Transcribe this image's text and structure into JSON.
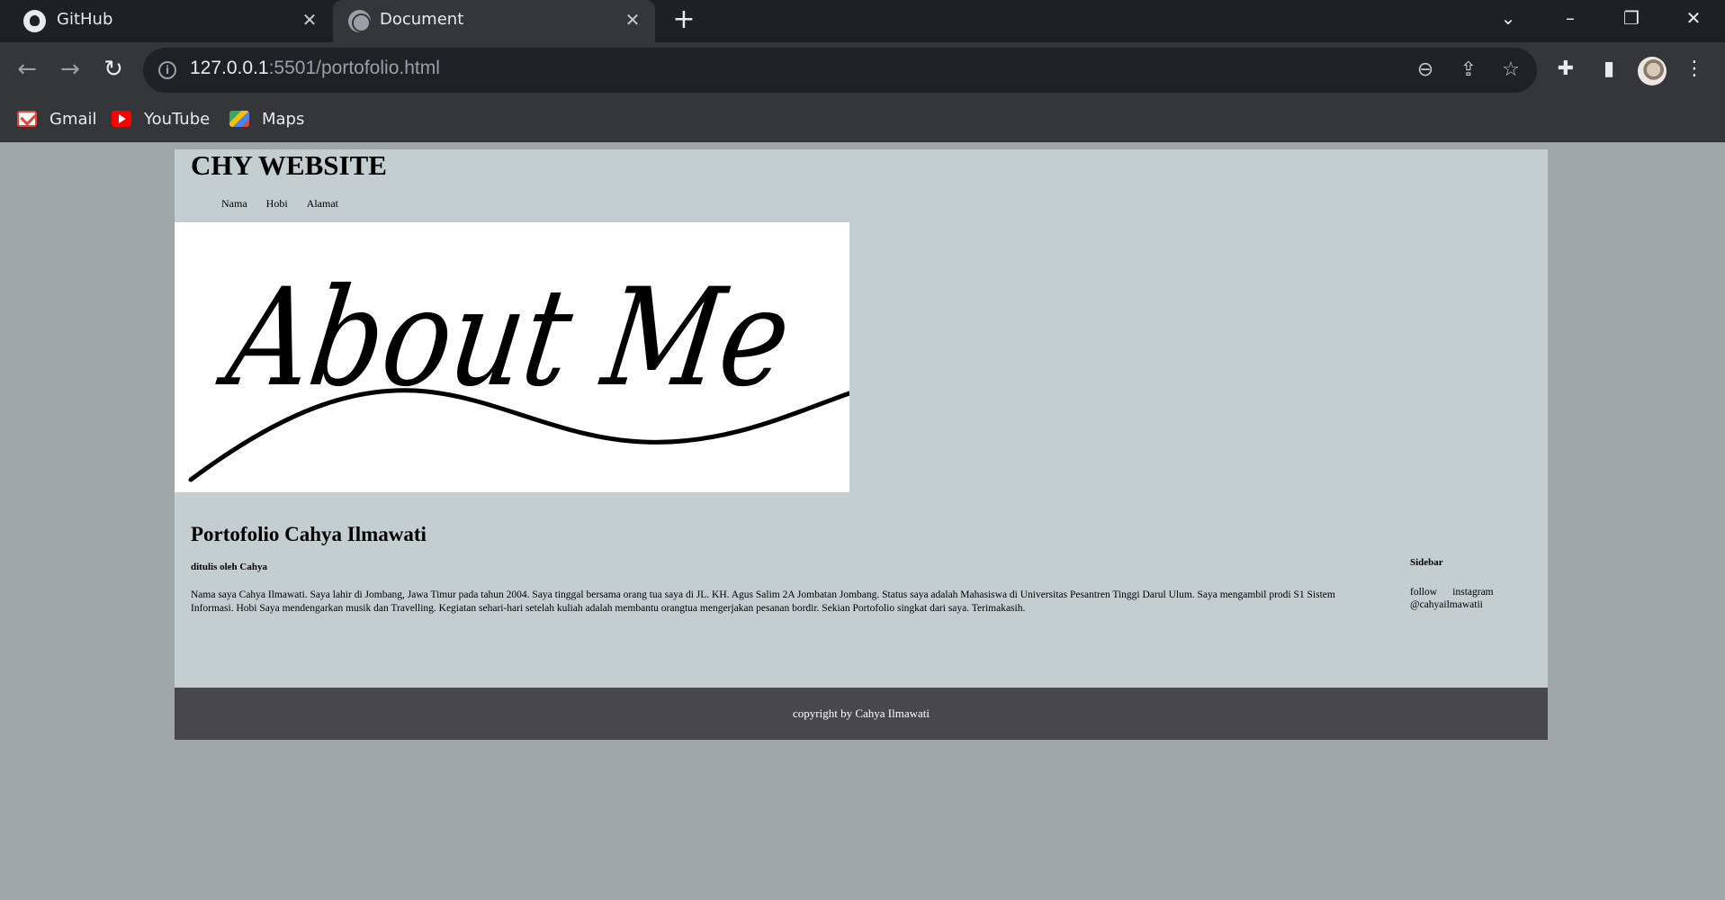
{
  "browser": {
    "tabs": [
      {
        "label": "GitHub",
        "icon": "github-icon"
      },
      {
        "label": "Document",
        "icon": "globe-icon"
      }
    ],
    "url_host": "127.0.0.1",
    "url_rest": ":5501/portofolio.html",
    "bookmarks": [
      {
        "label": "Gmail",
        "icon": "gmail-icon"
      },
      {
        "label": "YouTube",
        "icon": "youtube-icon"
      },
      {
        "label": "Maps",
        "icon": "maps-icon"
      }
    ]
  },
  "site": {
    "title": "CHY WEBSITE",
    "nav": [
      "Nama",
      "Hobi",
      "Alamat"
    ],
    "banner_text": "About Me"
  },
  "article": {
    "title": "Portofolio Cahya Ilmawati",
    "author": "ditulis oleh Cahya",
    "body": "Nama saya Cahya Ilmawati. Saya lahir di Jombang, Jawa Timur pada tahun 2004. Saya tinggal bersama orang tua saya di JL. KH. Agus Salim 2A Jombatan Jombang. Status saya adalah Mahasiswa di Universitas Pesantren Tinggi Darul Ulum. Saya mengambil prodi S1 Sistem Informasi. Hobi Saya mendengarkan musik dan Travelling. Kegiatan sehari-hari setelah kuliah adalah membantu orangtua mengerjakan pesanan bordir. Sekian Portofolio singkat dari saya. Terimakasih."
  },
  "sidebar": {
    "heading": "Sidebar",
    "text": "follow      instagram @cahyailmawatii"
  },
  "footer": {
    "text": "copyright by Cahya Ilmawati"
  },
  "colors": {
    "page_bg": "#a0a5a8",
    "content_bg": "#c4cdd0",
    "footer_bg": "#48484a"
  }
}
